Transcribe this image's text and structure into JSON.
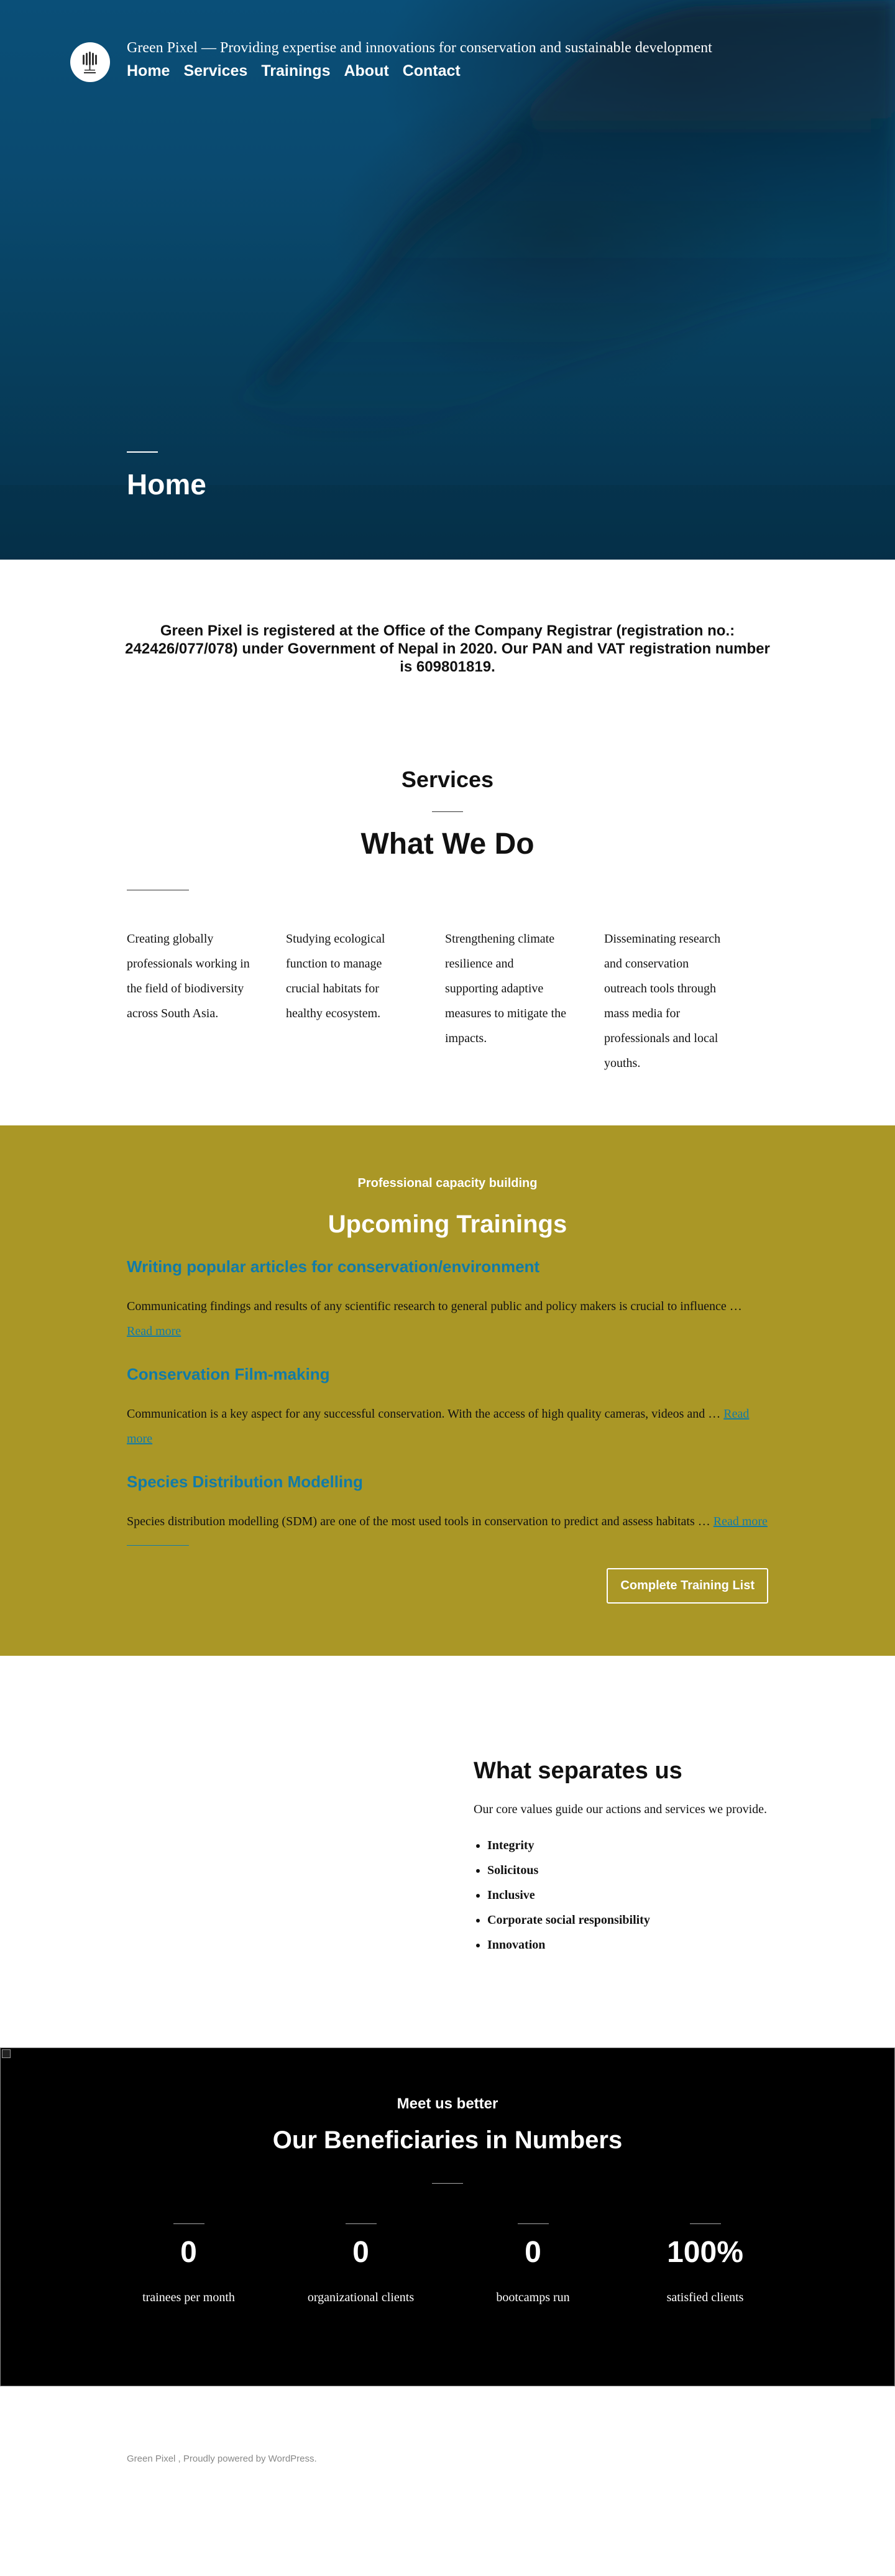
{
  "header": {
    "site_title": "Green Pixel",
    "separator": "—",
    "tagline": "Providing expertise and innovations for conservation and sustainable development",
    "nav": [
      "Home",
      "Services",
      "Trainings",
      "About",
      "Contact"
    ],
    "logo_icon": "tree-logo-icon"
  },
  "hero": {
    "title": "Home"
  },
  "registration": {
    "text": "Green Pixel is registered at the Office of the Company Registrar (registration no.: 242426/077/078) under Government of Nepal in 2020. Our PAN and VAT registration number is 609801819."
  },
  "services": {
    "heading": "Services",
    "subheading": "What We Do",
    "items": [
      "Creating globally professionals working in the field of biodiversity across South Asia.",
      "Studying ecological function to manage crucial habitats for healthy ecosystem.",
      "Strengthening climate resilience and supporting adaptive measures to mitigate the impacts.",
      "Disseminating research and conservation outreach tools through mass media for professionals and local youths."
    ]
  },
  "trainings": {
    "kicker": "Professional capacity building",
    "heading": "Upcoming Trainings",
    "items": [
      {
        "title": "Writing popular articles for conservation/environment",
        "excerpt": "Communicating findings and results of any scientific research to general public and policy makers is crucial to influence …",
        "more": "Read more"
      },
      {
        "title": "Conservation Film-making",
        "excerpt": "Communication is a key aspect for any successful conservation. With the access of high quality cameras, videos and …",
        "more": "Read more"
      },
      {
        "title": "Species Distribution Modelling",
        "excerpt": "Species distribution modelling (SDM) are one of the most used tools in conservation to predict and assess habitats …",
        "more": "Read more"
      }
    ],
    "button": "Complete Training List",
    "colors": {
      "background": "#aa9726",
      "link": "#117ba8"
    }
  },
  "values": {
    "heading": "What separates us",
    "intro": "Our core values guide our actions and services we provide.",
    "list": [
      "Integrity",
      "Solicitous",
      "Inclusive",
      "Corporate social responsibility",
      "Innovation"
    ]
  },
  "numbers": {
    "kicker": "Meet us better",
    "heading": "Our Beneficiaries in Numbers",
    "items": [
      {
        "value": "0",
        "label": "trainees per month"
      },
      {
        "value": "0",
        "label": "organizational clients"
      },
      {
        "value": "0",
        "label": "bootcamps run"
      },
      {
        "value": "100%",
        "label": "satisfied clients"
      }
    ]
  },
  "footer": {
    "text": "Green Pixel , Proudly powered by WordPress."
  }
}
